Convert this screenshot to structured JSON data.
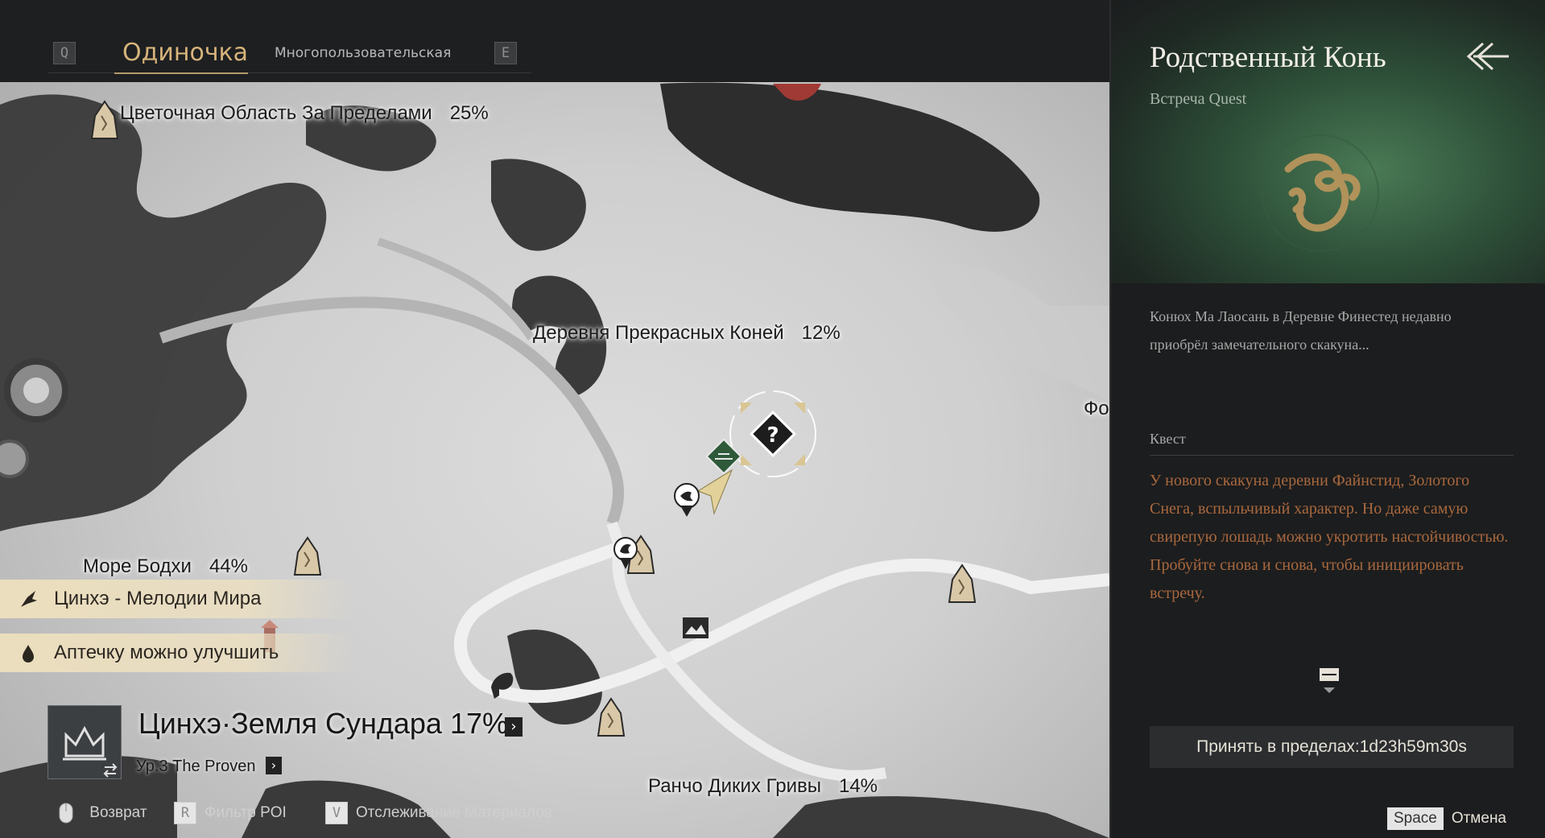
{
  "tabs": {
    "prev_key": "Q",
    "next_key": "E",
    "active": "Одиночка",
    "inactive": "Многопользовательская"
  },
  "map": {
    "labels": [
      {
        "name": "Цветочная Область За Пределами",
        "pct": "25%"
      },
      {
        "name": "Деревня Прекрасных Коней",
        "pct": "12%"
      },
      {
        "name": "Море Бодхи",
        "pct": "44%"
      },
      {
        "name": "Ранчо Диких Гривы",
        "pct": "14%"
      }
    ],
    "edge_label": "Фо",
    "notices": [
      {
        "text": "Цинхэ - Мелодии Мира",
        "icon": "bird-icon"
      },
      {
        "text": "Аптечку можно улучшить",
        "icon": "medkit-icon"
      }
    ],
    "region": {
      "title": "Цинхэ·Земля Сундара 17%",
      "level": "Ур.3 The Proven",
      "icon": "crown-icon"
    },
    "hints": [
      {
        "key": "",
        "icon": "mouse-icon",
        "label": "Возврат"
      },
      {
        "key": "R",
        "label": "Фильтр POI"
      },
      {
        "key": "V",
        "label": "Отслеживание Материалов"
      }
    ]
  },
  "panel": {
    "title": "Родственный Конь",
    "subtitle": "Встреча Quest",
    "intro": "Конюх Ма Лаосань в Деревне Финестед недавно приобрёл замечательного скакуна...",
    "section": "Квест",
    "description": "У нового скакуна деревни Файнстид, Золотого Снега, вспыльчивый характер. Но даже самую свирепую лошадь можно укротить настойчивостью. Пробуйте снова и снова, чтобы инициировать встречу.",
    "accept": "Принять в пределах:1d23h59m30s",
    "cancel_key": "Space",
    "cancel_label": "Отмена"
  },
  "colors": {
    "accent_gold": "#d7b47a",
    "quest_text": "#a9683e",
    "panel_bg": "#1c1d1e"
  }
}
